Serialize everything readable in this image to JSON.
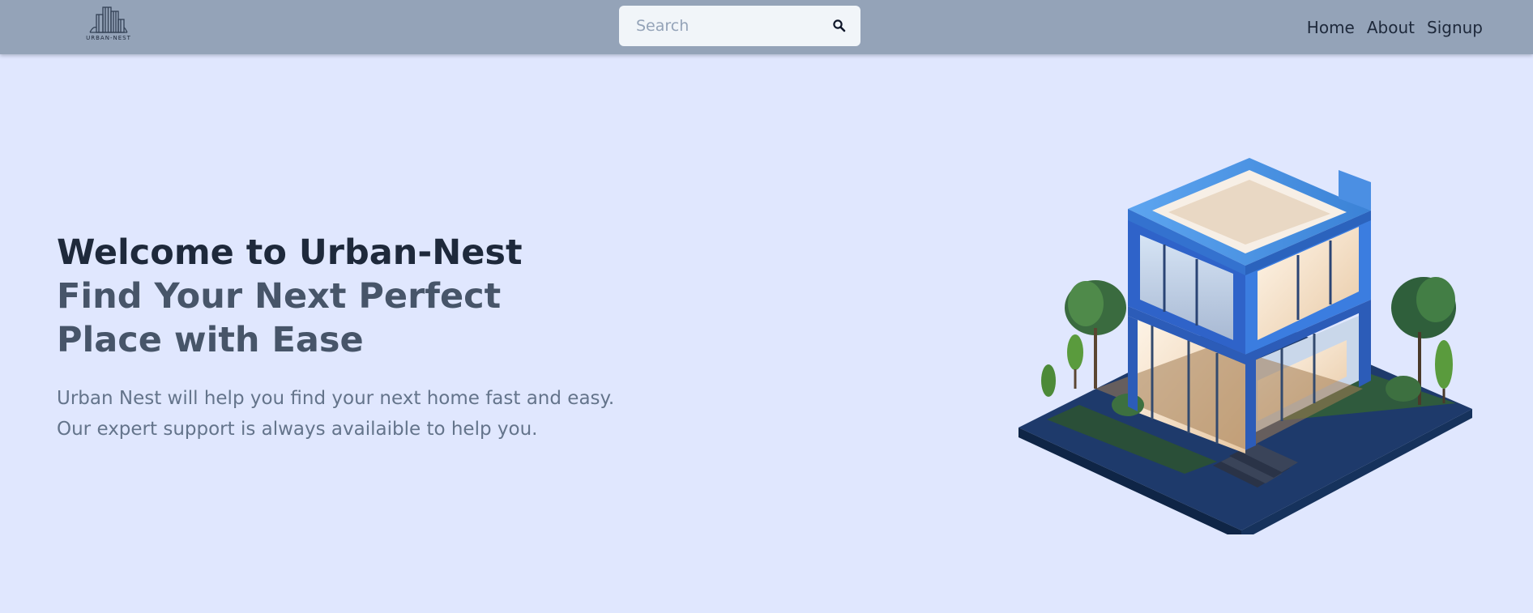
{
  "brand": {
    "logo_icon": "building-icon",
    "logo_text": "URBAN-NEST"
  },
  "search": {
    "placeholder": "Search",
    "icon": "search-icon"
  },
  "nav": {
    "items": [
      {
        "label": "Home"
      },
      {
        "label": "About"
      },
      {
        "label": "Signup"
      }
    ]
  },
  "hero": {
    "title_line1": "Welcome to Urban-Nest",
    "title_line2": "Find Your Next Perfect Place with Ease",
    "description_line1": "Urban Nest will help you find your next home fast and easy.",
    "description_line2": "Our expert support is always availaible to help you.",
    "image_icon": "isometric-house-illustration"
  },
  "colors": {
    "page_background": "#e0e7fe",
    "navbar_background": "#94a3b8",
    "heading_dark": "#1e293b",
    "heading_muted": "#475569",
    "body_text": "#64748b",
    "search_background": "#f1f5f9"
  }
}
